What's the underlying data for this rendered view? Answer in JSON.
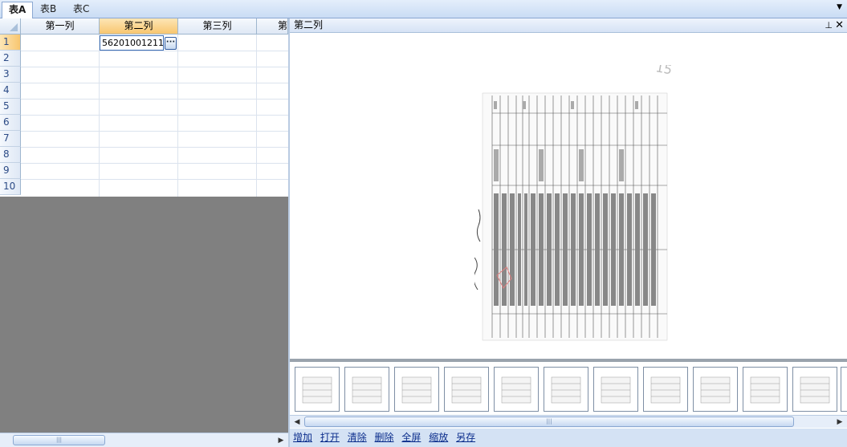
{
  "tabs": [
    {
      "label": "表A",
      "active": true
    },
    {
      "label": "表B",
      "active": false
    },
    {
      "label": "表C",
      "active": false
    }
  ],
  "grid": {
    "columns": [
      "第一列",
      "第二列",
      "第三列",
      "第"
    ],
    "selected_column": "第二列",
    "rows": [
      "1",
      "2",
      "3",
      "4",
      "5",
      "6",
      "7",
      "8",
      "9",
      "10"
    ],
    "selected_row": "1",
    "editing_cell_value": "56201001211",
    "ellipsis_label": "···"
  },
  "image_panel": {
    "title": "第二列",
    "pin_icon": "pin-icon",
    "close_icon": "close-icon",
    "thumbnail_count": 12
  },
  "actions": [
    "增加",
    "打开",
    "清除",
    "删除",
    "全屏",
    "缩放",
    "另存"
  ],
  "colors": {
    "selected_header": "#f8c66f",
    "tab_border": "#8ba8d2",
    "link": "#0b2d8c",
    "empty_area": "#808080"
  }
}
